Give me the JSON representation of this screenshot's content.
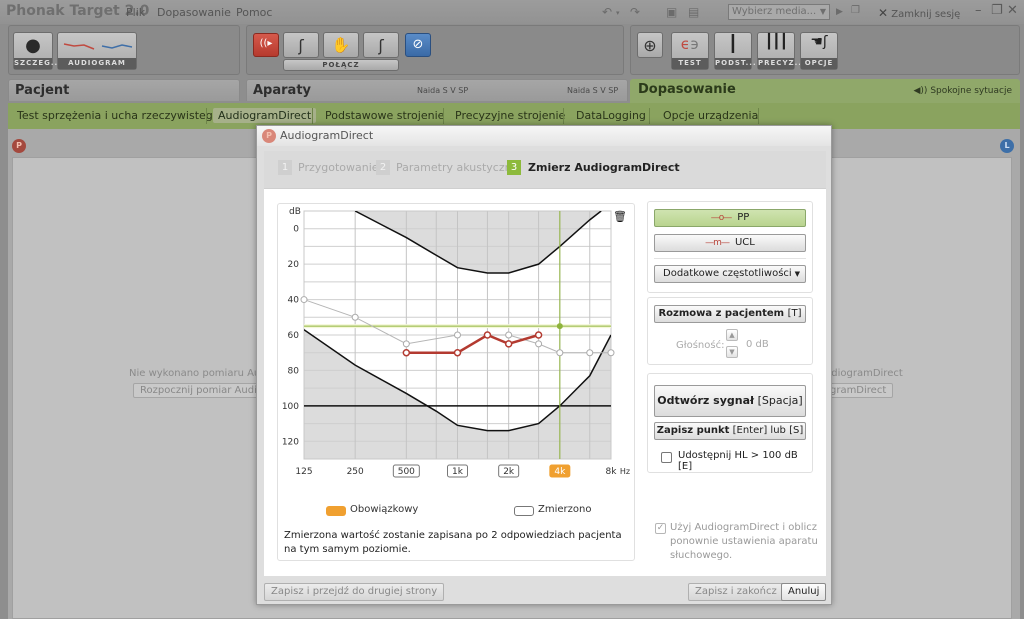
{
  "app": {
    "title": "Phonak Target 2.0",
    "menu": [
      "Plik",
      "Dopasowanie",
      "Pomoc"
    ],
    "media_select": "Wybierz media...",
    "close_session": "Zamknij sesję"
  },
  "toolbar": {
    "left": [
      {
        "label": "SZCZEG...",
        "icon": "person-icon"
      },
      {
        "label": "AUDIOGRAM",
        "icon": "audiogram-icon"
      }
    ],
    "middle": {
      "connect_label": "POŁĄCZ",
      "icons": [
        "noahlink-red-icon",
        "hearing-aid-left-icon",
        "hand-icon",
        "hearing-aid-right-icon",
        "mute-icon"
      ]
    },
    "right": [
      {
        "label": "",
        "icon": "target-icon"
      },
      {
        "label": "TEST",
        "icon": "ear-icon"
      },
      {
        "label": "PODST...",
        "icon": "slider-icon"
      },
      {
        "label": "PRECYZ...",
        "icon": "sliders-icon"
      },
      {
        "label": "OPCJE",
        "icon": "hand-device-icon"
      }
    ]
  },
  "sections": {
    "patient": "Pacjent",
    "devices": "Aparaty",
    "device_left": "Naida S V SP",
    "device_right": "Naida S V SP",
    "fitting": "Dopasowanie",
    "program": "Spokojne sytuacje"
  },
  "subnav": [
    {
      "label": "Test sprzężenia i ucha rzeczywistego",
      "active": false
    },
    {
      "label": "AudiogramDirect",
      "active": true
    },
    {
      "label": "Podstawowe strojenie",
      "active": false
    },
    {
      "label": "Precyzyjne strojenie",
      "active": false
    },
    {
      "label": "DataLogging",
      "active": false
    },
    {
      "label": "Opcje urządzenia",
      "active": false
    }
  ],
  "background_page": {
    "left_badge": "P",
    "right_badge": "L",
    "left_message": "Nie wykonano pomiaru AudiogramDirect",
    "left_button": "Rozpocznij pomiar AudiogramDirect",
    "right_message": "Nie wykonano pomiaru AudiogramDirect",
    "right_button": "Rozpocznij pomiar AudiogramDirect"
  },
  "dialog": {
    "badge": "P",
    "title": "AudiogramDirect",
    "steps": [
      {
        "num": "1",
        "label": "Przygotowanie",
        "active": false
      },
      {
        "num": "2",
        "label": "Parametry akustyczne",
        "active": false
      },
      {
        "num": "3",
        "label": "Zmierz AudiogramDirect",
        "active": true
      }
    ],
    "legend": {
      "mandatory": "Obowiązkowy",
      "measured": "Zmierzono",
      "mandatory_color": "#f0a030"
    },
    "note": "Zmierzona wartość zostanie zapisana po 2 odpowiedziach pacjenta na tym samym poziomie.",
    "mode_buttons": [
      {
        "marker": "—o—",
        "label": "PP",
        "selected": true
      },
      {
        "marker": "—m—",
        "label": "UCL",
        "selected": false
      }
    ],
    "extra_freq_select": "Dodatkowe częstotliwości",
    "talk_button": {
      "label": "Rozmowa z pacjentem",
      "shortcut": "[T]"
    },
    "volume": {
      "label": "Głośność:",
      "value": "0 dB"
    },
    "play_button": {
      "label": "Odtwórz sygnał",
      "shortcut": "[Spacja]"
    },
    "save_point_button": {
      "label": "Zapisz punkt",
      "shortcut": "[Enter] lub [S]"
    },
    "enable_hl_checkbox": {
      "label": "Udostępnij HL > 100 dB [E]",
      "checked": false
    },
    "use_ad_checkbox": {
      "label": "Użyj AudiogramDirect i oblicz ponownie ustawienia aparatu słuchowego.",
      "checked": true
    },
    "footer": {
      "save_next": "Zapisz i przejdź do drugiej strony",
      "save_finish": "Zapisz i zakończ",
      "cancel": "Anuluj"
    }
  },
  "chart_data": {
    "type": "line",
    "title": "",
    "ylabel": "dB",
    "xlabel": "Hz",
    "y_reversed": true,
    "ylim": [
      -10,
      130
    ],
    "yticks": [
      0,
      20,
      40,
      60,
      80,
      100,
      120
    ],
    "x_ticks": [
      {
        "label": "125",
        "hz": 125,
        "style": "plain"
      },
      {
        "label": "250",
        "hz": 250,
        "style": "plain"
      },
      {
        "label": "500",
        "hz": 500,
        "style": "measured"
      },
      {
        "label": "1k",
        "hz": 1000,
        "style": "measured"
      },
      {
        "label": "2k",
        "hz": 2000,
        "style": "measured"
      },
      {
        "label": "4k",
        "hz": 4000,
        "style": "mandatory"
      },
      {
        "label": "8k",
        "hz": 8000,
        "style": "plain"
      }
    ],
    "x_unit_label": "Hz",
    "grid_hz": [
      125,
      250,
      500,
      750,
      1000,
      1500,
      2000,
      3000,
      4000,
      6000,
      8000
    ],
    "grid": true,
    "series": [
      {
        "name": "Reference audiogram",
        "color": "#b5b5b5",
        "x": [
          125,
          250,
          500,
          1000,
          2000,
          3000,
          4000,
          6000,
          8000
        ],
        "y": [
          40,
          50,
          65,
          60,
          60,
          65,
          70,
          70,
          70
        ]
      },
      {
        "name": "PP (measured)",
        "color": "#b33a30",
        "x": [
          500,
          1000,
          1500,
          2000,
          3000
        ],
        "y": [
          70,
          70,
          60,
          65,
          60
        ]
      }
    ],
    "limits": {
      "upper_boundary": {
        "x": [
          250,
          500,
          750,
          1000,
          1500,
          2000,
          3000,
          4000,
          6000,
          7000
        ],
        "y": [
          -10,
          5,
          15,
          22,
          25,
          25,
          20,
          10,
          -5,
          -10
        ]
      },
      "lower_boundary": {
        "x": [
          125,
          250,
          500,
          750,
          1000,
          1500,
          2000,
          3000,
          4000,
          6000,
          8000
        ],
        "y": [
          57,
          77,
          93,
          103,
          111,
          114,
          114,
          110,
          100,
          83,
          60
        ]
      },
      "max_level_line_db": 100
    },
    "cursor": {
      "hz": 4000,
      "db": 55,
      "color": "#8fb43c"
    }
  }
}
